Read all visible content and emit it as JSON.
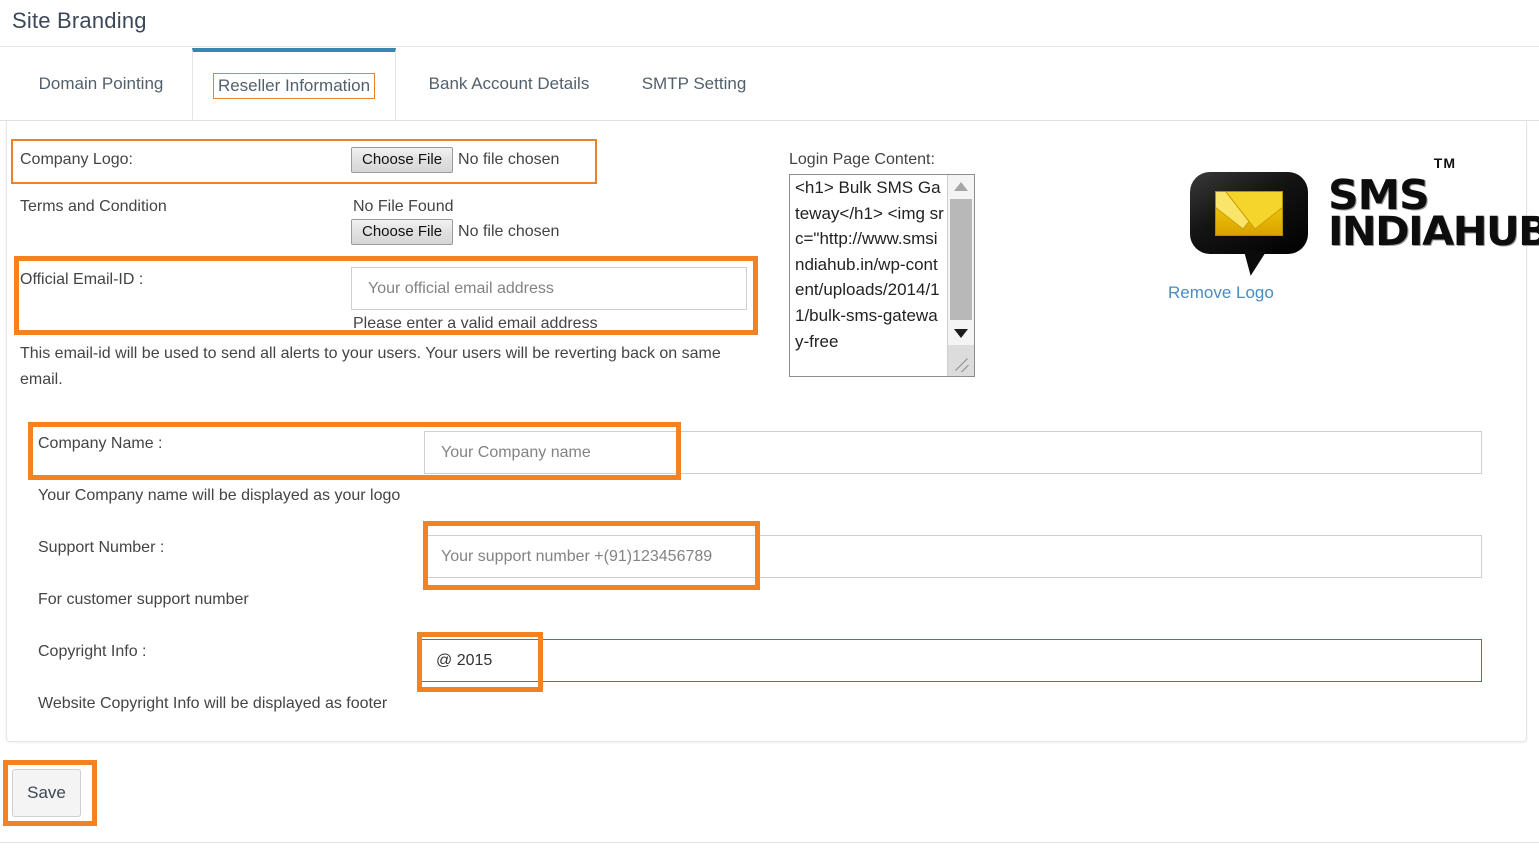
{
  "header": {
    "title": "Site Branding"
  },
  "tabs": [
    {
      "label": "Domain Pointing",
      "active": false
    },
    {
      "label": "Reseller Information",
      "active": true
    },
    {
      "label": "Bank Account Details",
      "active": false
    },
    {
      "label": "SMTP Setting",
      "active": false
    }
  ],
  "form": {
    "company_logo": {
      "label": "Company Logo:",
      "button_label": "Choose File",
      "file_status": "No file chosen"
    },
    "terms_and_condition": {
      "label": "Terms and Condition",
      "file_found_text": "No File Found",
      "button_label": "Choose File",
      "file_status": "No file chosen"
    },
    "official_email": {
      "label": "Official Email-ID :",
      "placeholder": "Your official email address",
      "value": "",
      "error": "Please enter a valid email address",
      "helper": "This email-id will be used to send all alerts to your users. Your users will be reverting back on same email."
    },
    "company_name": {
      "label": "Company Name :",
      "placeholder": "Your Company name",
      "value": "",
      "helper": "Your Company name will be displayed as your logo"
    },
    "support_number": {
      "label": "Support Number :",
      "placeholder": "Your support number +(91)123456789",
      "value": "",
      "helper": "For customer support number"
    },
    "copyright_info": {
      "label": "Copyright Info :",
      "placeholder": "",
      "value": "@ 2015",
      "helper": "Website Copyright Info will be displayed as footer"
    }
  },
  "login_page_content": {
    "label": "Login Page Content:",
    "value": "<h1> Bulk SMS Gateway</h1> <img src=\"http://www.smsindiahub.in/wp-content/uploads/2014/11/bulk-sms-gateway-free"
  },
  "logo": {
    "trademark": "TM",
    "word_line_1": "SMS",
    "word_line_2": "INDIAHUB",
    "remove_link": "Remove Logo"
  },
  "actions": {
    "save_label": "Save"
  },
  "colors": {
    "highlight_orange": "#f58220",
    "active_tab_blue": "#3a87ad",
    "link_blue": "#4a8bc2",
    "focus_blue": "#3a7ca8"
  }
}
